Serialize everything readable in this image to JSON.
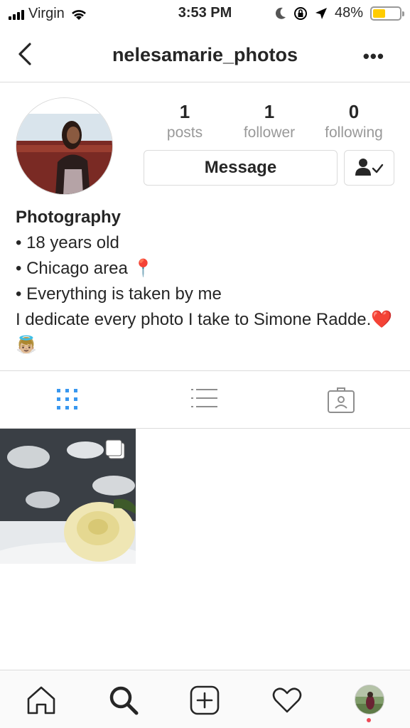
{
  "status_bar": {
    "carrier": "Virgin",
    "time": "3:53 PM",
    "battery": "48%",
    "battery_level": 0.48
  },
  "nav": {
    "username": "nelesamarie_photos",
    "back_icon": "chevron-left-icon",
    "more_icon": "ellipsis-icon"
  },
  "profile": {
    "posts_count": "1",
    "posts_label": "posts",
    "followers_count": "1",
    "followers_label": "follower",
    "following_count": "0",
    "following_label": "following",
    "message_label": "Message",
    "follow_icon": "user-check-icon"
  },
  "bio": {
    "name": "Photography",
    "lines": [
      "• 18 years old",
      "• Chicago area 📍",
      "• Everything is taken by me"
    ],
    "dedication": "I dedicate every photo I take to Simone Radde.❤️👼🏼"
  },
  "tabs": [
    {
      "icon": "grid-icon",
      "active": true
    },
    {
      "icon": "list-icon",
      "active": false
    },
    {
      "icon": "tagged-icon",
      "active": false
    }
  ],
  "colors": {
    "accent": "#3897f0",
    "border": "#dbdbdb",
    "muted": "#999999",
    "notification": "#ed4956"
  }
}
